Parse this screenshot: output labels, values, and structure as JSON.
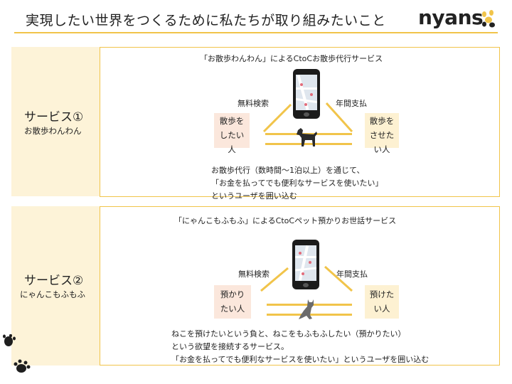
{
  "header": {
    "title": "実現したい世界をつくるために私たちが取り組みたいこと",
    "logo_text": "nyans"
  },
  "services": [
    {
      "name": "サービス①",
      "sub": "お散歩わんわん",
      "caption": "「お散歩わんわん」によるCtoCお散歩代行サービス",
      "left_box": [
        "散歩を",
        "したい",
        "人"
      ],
      "right_box": [
        "散歩を",
        "させた",
        "い人"
      ],
      "left_label": "無料検索",
      "right_label": "年間支払",
      "body": [
        "お散歩代行（数時間〜1泊以上）を通じて、",
        "「お金を払ってでも便利なサービスを使いたい」",
        "というユーザを囲い込む"
      ]
    },
    {
      "name": "サービス②",
      "sub": "にゃんこもふもふ",
      "caption": "「にゃんこもふもふ」によるCtoCペット預かりお世話サービス",
      "left_box": [
        "預かり",
        "たい人"
      ],
      "right_box": [
        "預けた",
        "い人"
      ],
      "left_label": "無料検索",
      "right_label": "年間支払",
      "body": [
        "ねこを預けたいという負と、ねこをもふもふしたい（預かりたい）",
        "という欲望を接続するサービス。",
        "「お金を払ってでも便利なサービスを使いたい」というユーザを囲い込む"
      ]
    }
  ],
  "icons": [
    "paw-icon",
    "phone-icon",
    "dog-icon",
    "cat-icon"
  ],
  "colors": {
    "accent": "#f1c44a",
    "side_bg": "#fdf3d8",
    "left_box_bg": "#fbe7dc",
    "right_box_bg": "#fdf1d2"
  }
}
